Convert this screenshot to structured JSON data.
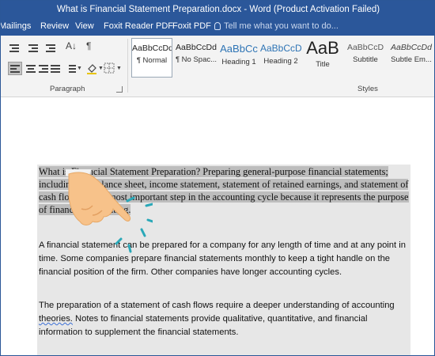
{
  "window": {
    "title": "What is Financial Statement Preparation.docx - Word (Product Activation Failed)"
  },
  "ribbon_tabs": [
    {
      "label": "Mailings"
    },
    {
      "label": "Review"
    },
    {
      "label": "View"
    },
    {
      "label": "Foxit Reader PDF"
    },
    {
      "label": "Foxit PDF"
    }
  ],
  "tell_me": {
    "placeholder": "Tell me what you want to do..."
  },
  "groups": {
    "paragraph_label": "Paragraph",
    "styles_label": "Styles"
  },
  "styles": [
    {
      "sample": "AaBbCcDd",
      "name": "¶ Normal",
      "selected": true
    },
    {
      "sample": "AaBbCcDd",
      "name": "¶ No Spac...",
      "selected": false
    },
    {
      "sample": "AaBbCc",
      "name": "Heading 1",
      "selected": false
    },
    {
      "sample": "AaBbCcD",
      "name": "Heading 2",
      "selected": false
    },
    {
      "sample": "AaB",
      "name": "Title",
      "selected": false
    },
    {
      "sample": "AaBbCcD",
      "name": "Subtitle",
      "selected": false
    },
    {
      "sample": "AaBbCcDd",
      "name": "Subtle Em...",
      "selected": false
    }
  ],
  "document": {
    "paragraphs": [
      "What is Financial Statement Preparation? Preparing general-purpose financial statements; including the balance sheet, income statement, statement of retained earnings, and statement of cash flows; is the most important step in the accounting cycle because it represents the purpose of financial accounting.",
      "A financial statement can be prepared for a company for any length of time and at any point in time. Some companies prepare financial statements monthly to keep a tight handle on the financial position of the firm. Other companies have longer accounting cycles.",
      "The preparation of a statement of cash flows require a deeper understanding of accounting theories. Notes to financial statements provide qualitative, quantitative, and financial information to supplement the financial statements."
    ],
    "p3_squiggle_word": "theories"
  },
  "colors": {
    "title_bar": "#2b579a",
    "ribbon": "#f3f3f3",
    "highlight": "#bdbdbd",
    "hand_skin": "#f7c28a",
    "hand_sleeve": "#f2f2f2",
    "tap_marks": "#2aa8b8"
  },
  "icons": {
    "pointer": "pointing-hand-icon",
    "tell_me": "lightbulb-icon"
  }
}
